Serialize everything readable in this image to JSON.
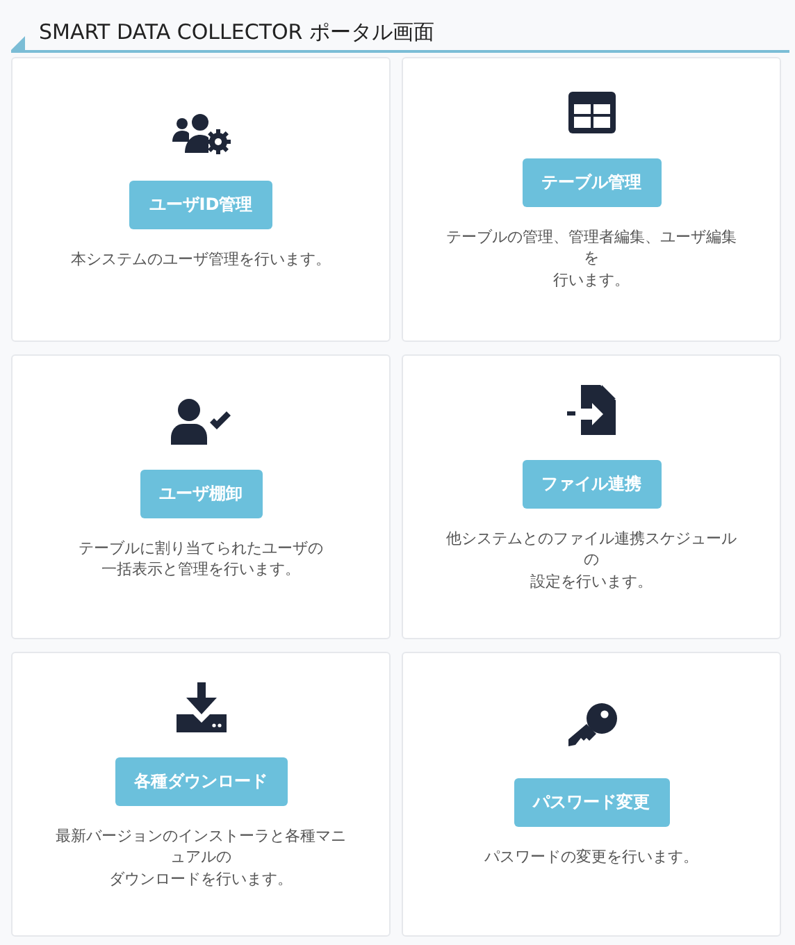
{
  "header": {
    "title": "SMART DATA COLLECTOR ポータル画面"
  },
  "cards": [
    {
      "button": "ユーザID管理",
      "description": [
        "本システムのユーザ管理を行います。"
      ]
    },
    {
      "button": "テーブル管理",
      "description": [
        "テーブルの管理、管理者編集、ユーザ編集",
        "を",
        "行います。"
      ]
    },
    {
      "button": "ユーザ棚卸",
      "description": [
        "テーブルに割り当てられたユーザの",
        "一括表示と管理を行います。"
      ]
    },
    {
      "button": "ファイル連携",
      "description": [
        "他システムとのファイル連携スケジュール",
        "の",
        "設定を行います。"
      ]
    },
    {
      "button": "各種ダウンロード",
      "description": [
        "最新バージョンのインストーラと各種マニ",
        "ュアルの",
        "ダウンロードを行います。"
      ]
    },
    {
      "button": "パスワード変更",
      "description": [
        "パスワードの変更を行います。"
      ]
    }
  ]
}
